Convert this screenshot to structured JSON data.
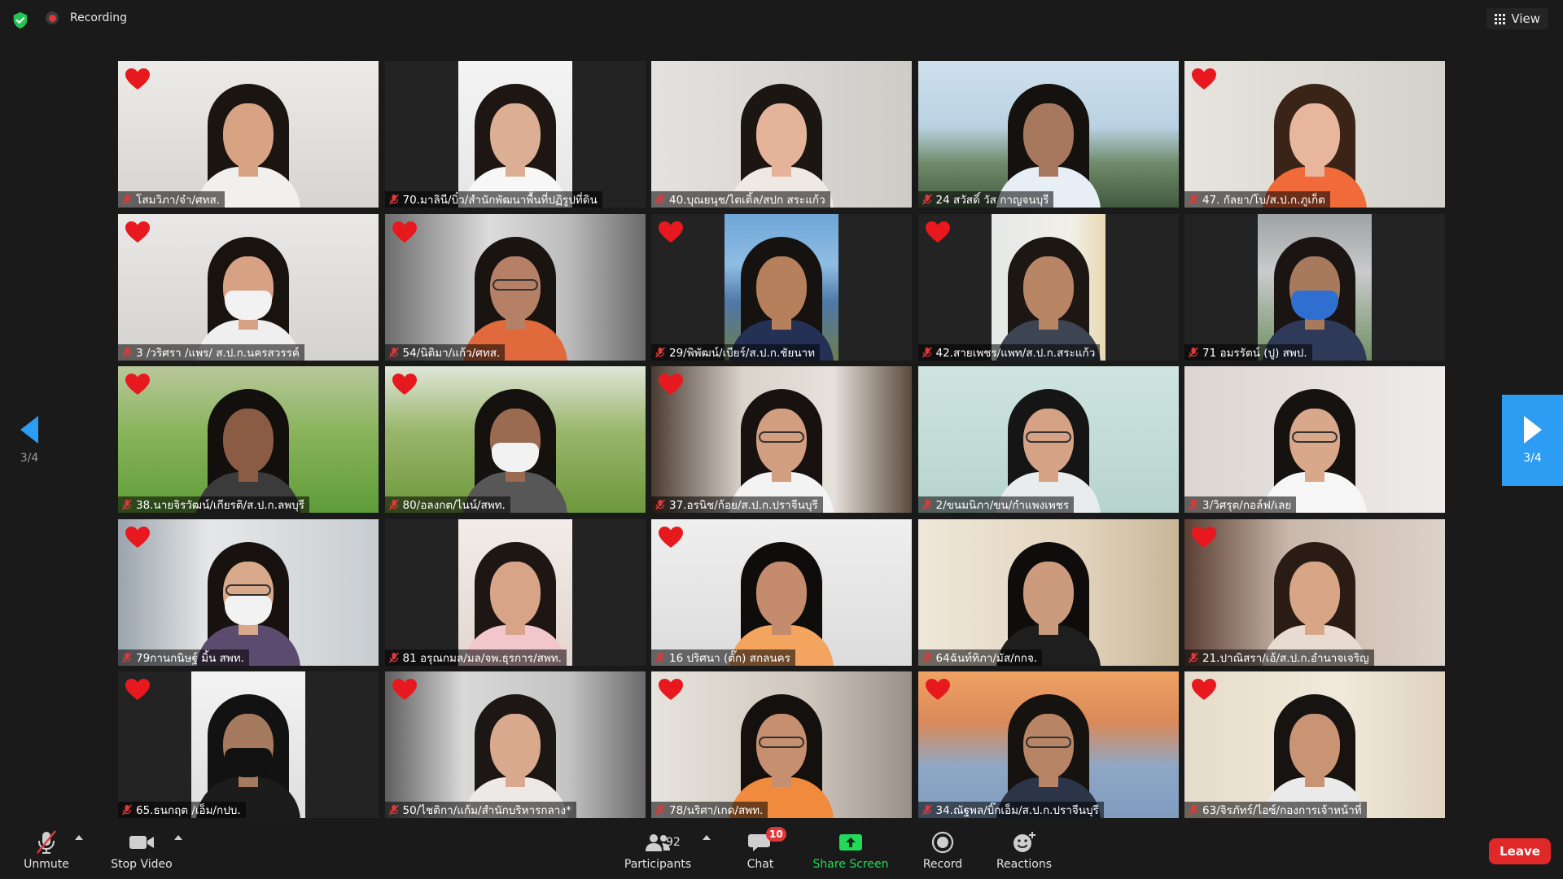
{
  "topbar": {
    "recording_label": "Recording",
    "view_label": "View"
  },
  "navigation": {
    "page_indicator": "3/4"
  },
  "participants": [
    {
      "name": "โสมวิภา/จ๋า/ศทส.",
      "heart": true,
      "look": {
        "bg": "linear-gradient(180deg,#ecebe8,#d7d5d1)",
        "hair": "#1b1512",
        "skin": "#d8a383",
        "shirt": "#f2f0ee"
      }
    },
    {
      "name": "70.มาลินี/บิ๋ว/สำนักพัฒนาพื้นที่ปฏิรูปที่ดิน",
      "heart": false,
      "narrow": true,
      "look": {
        "bg": "linear-gradient(180deg,#f4f4f4,#e6e6e6)",
        "hair": "#1e1612",
        "skin": "#dcae94",
        "shirt": "#f7f7f7"
      }
    },
    {
      "name": "40.บุณยนุช/ไตเติ้ล/สปก สระแก้ว",
      "heart": false,
      "look": {
        "bg": "linear-gradient(90deg,#e4e2e0,#cfcbc7)",
        "hair": "#1c1612",
        "skin": "#e5b39a",
        "shirt": "#efe9e3"
      }
    },
    {
      "name": "24 สวัสดิ์ วัส กาญจนบุรี",
      "heart": false,
      "look": {
        "bg": "linear-gradient(180deg,#cfe0ec 0%,#b9d2e2 45%,#6f8a6a 70%,#42593f 100%)",
        "hair": "#14110f",
        "skin": "#a8785e",
        "shirt": "#e7eef6"
      }
    },
    {
      "name": "47. กัลยา/โบ/ส.ป.ก.ภูเก็ต",
      "heart": true,
      "look": {
        "bg": "linear-gradient(90deg,#e7e4df,#d4d0ca)",
        "hair": "#3a2418",
        "skin": "#e8b69c",
        "shirt": "#f06a3a"
      }
    },
    {
      "name": "3 /วริศรา /แพร/ ส.ป.ก.นครสวรรค์",
      "heart": true,
      "mask": true,
      "look": {
        "bg": "linear-gradient(180deg,#e9e8e6,#d5d3d0)",
        "hair": "#18130f",
        "skin": "#d7a284",
        "shirt": "#efefef"
      }
    },
    {
      "name": "54/นิติมา/แก้ว/ศทส.",
      "heart": true,
      "glasses": true,
      "look": {
        "bg": "linear-gradient(90deg,#6d6d6d,#dcdcdc 40%,#bcbcbc 70%,#6a6a6a)",
        "hair": "#1a1410",
        "skin": "#b58066",
        "shirt": "#e06a3c"
      }
    },
    {
      "name": "29/พิพัฒน์/เบียร์/ส.ป.ก.ชัยนาท",
      "heart": true,
      "narrow": true,
      "look": {
        "bg": "linear-gradient(180deg,#6fa6d8 0%,#8fbde3 35%,#4f79a8 60%,#6e7d4c 100%)",
        "hair": "#151210",
        "skin": "#b6805d",
        "shirt": "#243155"
      }
    },
    {
      "name": "42.สายเพชร/แพท/ส.ป.ก.สระแก้ว",
      "heart": true,
      "narrow": true,
      "look": {
        "bg": "linear-gradient(90deg,#e6e8e7,#f1efe9 70%,#e8d8b1)",
        "hair": "#1d1713",
        "skin": "#b88565",
        "shirt": "#3d4452"
      }
    },
    {
      "name": "71 อมรรัตน์ (ปู) สพป.",
      "heart": false,
      "mask": true,
      "narrow": true,
      "look": {
        "bg": "linear-gradient(180deg,#9ea3a5 0%,#c9cbcc 40%,#6f8f63 100%)",
        "hair": "#1a1512",
        "skin": "#a77a5e",
        "shirt": "#2e3a57"
      }
    },
    {
      "name": "38.นายจิรวัฒน์/เกียรติ/ส.ป.ก.ลพบุรี",
      "heart": true,
      "look": {
        "bg": "linear-gradient(180deg,#b9c79b 0%,#89b45c 45%,#5f9c38 100%)",
        "hair": "#120f0d",
        "skin": "#8a5c43",
        "shirt": "#3b3b3b"
      }
    },
    {
      "name": "80/อลงกต/ไนน์/สพท.",
      "heart": true,
      "mask": true,
      "look": {
        "bg": "linear-gradient(180deg,#dfe6d8 0%,#99b56a 45%,#6e983d 100%)",
        "hair": "#14110f",
        "skin": "#9a6b50",
        "shirt": "#575757"
      }
    },
    {
      "name": "37.อรนิช/ก้อย/ส.ป.ก.ปราจีนบุรี",
      "heart": true,
      "glasses": true,
      "look": {
        "bg": "linear-gradient(90deg,#4a3b32,#d9d3cb 35%,#e6e1da 70%,#5a4a3e)",
        "hair": "#17120f",
        "skin": "#d29e80",
        "shirt": "#f3f3f3"
      }
    },
    {
      "name": "2/ขนมนิภา/ขน/กำแพงเพชร",
      "heart": false,
      "glasses": true,
      "look": {
        "bg": "linear-gradient(180deg,#cfe4df,#b6d4cd)",
        "hair": "#151515",
        "skin": "#d6a286",
        "shirt": "#e9ecef"
      }
    },
    {
      "name": "3/วิศรุต/กอล์ฟ/เลย",
      "heart": false,
      "glasses": true,
      "look": {
        "bg": "linear-gradient(90deg,#dcd6d2,#efebe8)",
        "hair": "#151210",
        "skin": "#d9a789",
        "shirt": "#f6f6f6"
      }
    },
    {
      "name": "79กานกนิษฐ์ มิ้น สพท.",
      "heart": true,
      "mask": true,
      "glasses": true,
      "look": {
        "bg": "linear-gradient(90deg,#9aa4ac,#e6e7e8 35%,#c8cdd1)",
        "hair": "#17120f",
        "skin": "#d9a98b",
        "shirt": "#5b4b6e"
      }
    },
    {
      "name": "81 อรุณกมล/มล/จพ.ธุรการ/สพท.",
      "heart": false,
      "narrow": true,
      "look": {
        "bg": "linear-gradient(180deg,#f2ece8,#e3d6cf)",
        "hair": "#1d1613",
        "skin": "#d7a487",
        "shirt": "#f1c7cc"
      }
    },
    {
      "name": "16 ปริศนา (ตั๊ก) สกลนคร",
      "heart": true,
      "look": {
        "bg": "linear-gradient(180deg,#efefef,#dcdcdc)",
        "hair": "#0f0d0c",
        "skin": "#c48c6c",
        "shirt": "#f3a45f"
      }
    },
    {
      "name": "64ฉันท์ทิภา/มัส/กกจ.",
      "heart": false,
      "look": {
        "bg": "linear-gradient(90deg,#efe7d9,#e3d5bf 60%,#c9b698)",
        "hair": "#0f0d0c",
        "skin": "#cc9a7c",
        "shirt": "#1e1e1e"
      }
    },
    {
      "name": "21.ปาณิสรา/เอ้/ส.ป.ก.อำนาจเจริญ",
      "heart": true,
      "look": {
        "bg": "linear-gradient(90deg,#5b3f34,#c9b8ab 40%,#ddd2c9)",
        "hair": "#2a1c15",
        "skin": "#d8a687",
        "shirt": "#e8dbd2"
      }
    },
    {
      "name": "65.ธนกฤต /เอ็ม/กปบ.",
      "heart": true,
      "mask": true,
      "narrow": true,
      "look": {
        "bg": "linear-gradient(180deg,#f3f3f3,#dedede)",
        "hair": "#121212",
        "skin": "#a67a5e",
        "shirt": "#1c1c1c"
      }
    },
    {
      "name": "50/ไชติกา/แก้ม/สำนักบริหารกลาง*",
      "heart": true,
      "look": {
        "bg": "linear-gradient(90deg,#5e5e5e,#d9d9d9 30%,#c4c4c4 70%,#6a6a6a)",
        "hair": "#1c1714",
        "skin": "#d9a98e",
        "shirt": "#ede9e6"
      }
    },
    {
      "name": "78/นริศา/เกด/สพท.",
      "heart": true,
      "glasses": true,
      "look": {
        "bg": "linear-gradient(90deg,#e7e3dd,#cfc7bd 60%,#9b9089)",
        "hair": "#14100e",
        "skin": "#c68f70",
        "shirt": "#f08a3c"
      }
    },
    {
      "name": "34.ณัฐพล/บิ๊กเอ็ม/ส.ป.ก.ปราจีนบุรี",
      "heart": true,
      "glasses": true,
      "look": {
        "bg": "linear-gradient(180deg,#f0a263 0%,#d98a5a 35%,#8fa7c6 65%,#7f9cc0 100%)",
        "hair": "#161210",
        "skin": "#b78466",
        "shirt": "#2c3448"
      }
    },
    {
      "name": "63/จิรภัทร์/ไอซ์/กองการเจ้าหน้าที่",
      "heart": true,
      "look": {
        "bg": "linear-gradient(90deg,#e6dccb,#f1e9da 60%,#dfd3c0)",
        "hair": "#171310",
        "skin": "#c99474",
        "shirt": "#eaeaea"
      }
    }
  ],
  "toolbar": {
    "unmute_label": "Unmute",
    "stop_video_label": "Stop Video",
    "participants_label": "Participants",
    "participants_count": "92",
    "chat_label": "Chat",
    "chat_badge": "10",
    "share_screen_label": "Share Screen",
    "record_label": "Record",
    "reactions_label": "Reactions",
    "leave_label": "Leave"
  },
  "colors": {
    "accent_blue": "#2d9cf3",
    "share_green": "#23d959",
    "leave_red": "#e02828",
    "heart_red": "#e8191e",
    "mic_muted_red": "#e0383a"
  },
  "icons": {
    "security": "shield-check-icon",
    "recording": "recording-dot-icon",
    "view": "grid-view-icon",
    "tile_reaction": "heart-icon",
    "tile_mic": "mic-muted-icon"
  }
}
